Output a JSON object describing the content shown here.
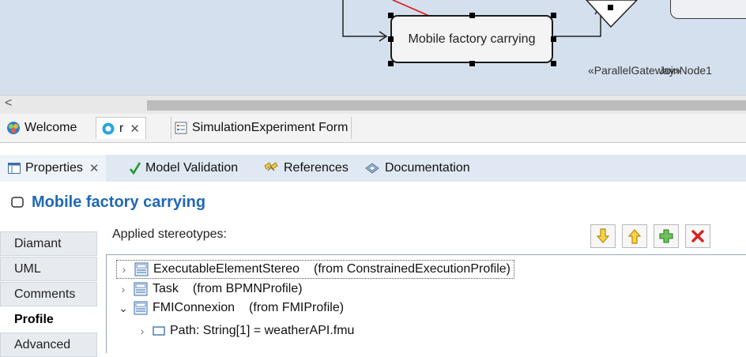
{
  "diagram": {
    "task_label": "Mobile factory carrying",
    "gateway_label": "«ParallelGateway»",
    "join_label": "JoinNode1",
    "colors": {
      "canvas": "#d4e0ee",
      "pointer_arrow": "#e0161b"
    }
  },
  "scrollbar": {
    "left_arrow": "<"
  },
  "editor_tabs": [
    {
      "label": "Welcome",
      "icon": "welcome-icon"
    },
    {
      "label": "r",
      "icon": "model-icon",
      "close": "✕"
    },
    {
      "label": "SimulationExperiment Form",
      "icon": "form-icon"
    }
  ],
  "properties": {
    "tabs": [
      {
        "label": "Properties",
        "icon": "properties-icon",
        "close": "✕"
      },
      {
        "label": "Model Validation",
        "icon": "checkmark-icon"
      },
      {
        "label": "References",
        "icon": "references-icon"
      },
      {
        "label": "Documentation",
        "icon": "documentation-icon"
      }
    ],
    "title": "Mobile factory carrying",
    "sidebar": [
      "Diamant",
      "UML",
      "Comments",
      "Profile",
      "Advanced"
    ],
    "selected_sidebar": "Profile",
    "applied_label": "Applied stereotypes:",
    "buttons": [
      {
        "name": "move-down",
        "icon": "arrow-down-icon",
        "color": "#e8b400"
      },
      {
        "name": "move-up",
        "icon": "arrow-up-icon",
        "color": "#e8b400"
      },
      {
        "name": "add",
        "icon": "plus-icon",
        "color": "#4caf50"
      },
      {
        "name": "remove",
        "icon": "delete-icon",
        "color": "#d92020"
      }
    ],
    "tree": [
      {
        "name": "ExecutableElementStereo",
        "source": "(from ConstrainedExecutionProfile)",
        "expanded": false
      },
      {
        "name": "Task",
        "source": "(from BPMNProfile)",
        "expanded": false
      },
      {
        "name": "FMIConnexion",
        "source": "(from FMIProfile)",
        "expanded": true
      },
      {
        "name": "Path: String[1] = weatherAPI.fmu",
        "child": true
      }
    ]
  }
}
